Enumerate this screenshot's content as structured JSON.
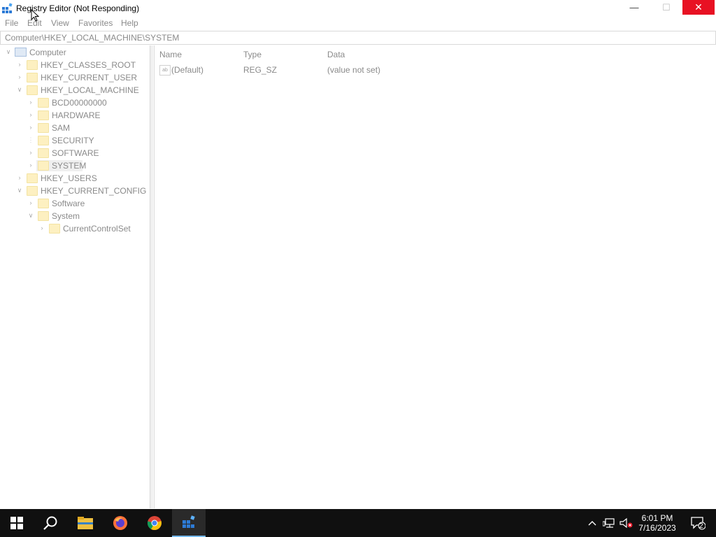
{
  "window": {
    "title": "Registry Editor (Not Responding)",
    "minimize_glyph": "—",
    "maximize_glyph": "☐",
    "close_glyph": "✕"
  },
  "menu": {
    "items": [
      "File",
      "Edit",
      "View",
      "Favorites",
      "Help"
    ]
  },
  "address": {
    "path": "Computer\\HKEY_LOCAL_MACHINE\\SYSTEM"
  },
  "tree": {
    "root": "Computer",
    "nodes": [
      {
        "label": "HKEY_CLASSES_ROOT",
        "expanded": false
      },
      {
        "label": "HKEY_CURRENT_USER",
        "expanded": false
      },
      {
        "label": "HKEY_LOCAL_MACHINE",
        "expanded": true
      },
      {
        "label": "BCD00000000",
        "expanded": false
      },
      {
        "label": "HARDWARE",
        "expanded": false
      },
      {
        "label": "SAM",
        "expanded": false
      },
      {
        "label": "SECURITY",
        "expanded": false
      },
      {
        "label": "SOFTWARE",
        "expanded": false
      },
      {
        "label": "SYSTEM",
        "expanded": false,
        "selected": true
      },
      {
        "label": "HKEY_USERS",
        "expanded": false
      },
      {
        "label": "HKEY_CURRENT_CONFIG",
        "expanded": true
      },
      {
        "label": "Software",
        "expanded": false
      },
      {
        "label": "System",
        "expanded": true
      },
      {
        "label": "CurrentControlSet",
        "expanded": false
      }
    ]
  },
  "values_list": {
    "columns": [
      "Name",
      "Type",
      "Data"
    ],
    "rows": [
      {
        "name": "(Default)",
        "type": "REG_SZ",
        "data": "(value not set)",
        "icon": "string-value-icon",
        "icon_text": "ab"
      }
    ]
  },
  "taskbar": {
    "apps": [
      "start-button",
      "search-icon",
      "file-explorer-icon",
      "firefox-icon",
      "chrome-icon",
      "registry-editor-icon"
    ],
    "clock_time": "6:01 PM",
    "clock_date": "7/16/2023",
    "notification_count": "2"
  },
  "colors": {
    "close_button": "#e81123",
    "taskbar": "#101010",
    "folder": "#fdf0c1",
    "dimmed_text": "#8a8a8a"
  }
}
